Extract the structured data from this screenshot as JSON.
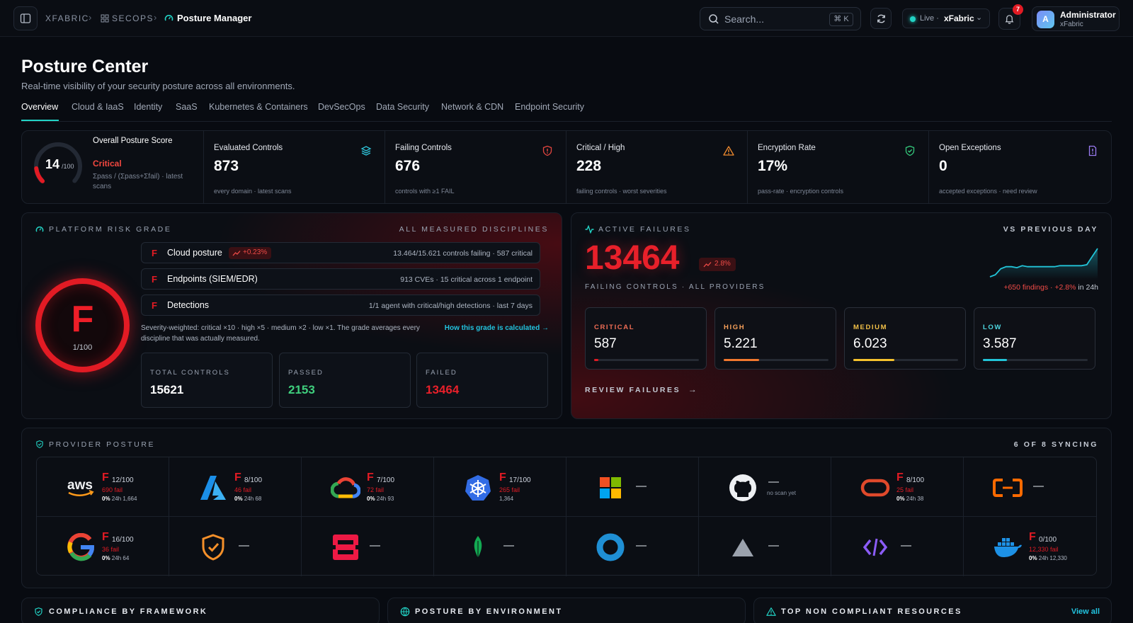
{
  "breadcrumb": {
    "root": "XFABRIC",
    "section": "SECOPS",
    "current": "Posture Manager"
  },
  "search": {
    "placeholder": "Search...",
    "shortcut": "⌘ K"
  },
  "env": {
    "live_label": "Live ·",
    "tenant": "xFabric"
  },
  "notifications": {
    "count": "7"
  },
  "user": {
    "initial": "A",
    "name": "Administrator",
    "org": "xFabric"
  },
  "page": {
    "title": "Posture Center",
    "subtitle": "Real-time visibility of your security posture across all environments."
  },
  "tabs": [
    "Overview",
    "Cloud & IaaS",
    "Identity",
    "SaaS",
    "Kubernetes & Containers",
    "DevSecOps",
    "Data Security",
    "Network & CDN",
    "Endpoint Security"
  ],
  "score": {
    "title": "Overall Posture Score",
    "value": "14",
    "max": "/100",
    "status": "Critical",
    "formula": "Σpass / (Σpass+Σfail) · latest scans",
    "fraction": 0.14
  },
  "kpis": [
    {
      "title": "Evaluated Controls",
      "value": "873",
      "sub": "every domain · latest scans",
      "icon": "layers-icon",
      "color": "#2fc2d8"
    },
    {
      "title": "Failing Controls",
      "value": "676",
      "sub": "controls with ≥1 FAIL",
      "icon": "shield-alert-icon",
      "color": "#e2453f"
    },
    {
      "title": "Critical / High",
      "value": "228",
      "sub": "failing controls · worst severities",
      "icon": "warning-icon",
      "color": "#f08a2e"
    },
    {
      "title": "Encryption Rate",
      "value": "17%",
      "sub": "pass-rate · encryption controls",
      "icon": "shield-check-icon",
      "color": "#34c77b"
    },
    {
      "title": "Open Exceptions",
      "value": "0",
      "sub": "accepted exceptions · need review",
      "icon": "file-alert-icon",
      "color": "#9b7bf2"
    }
  ],
  "risk": {
    "label": "PLATFORM RISK GRADE",
    "scope": "ALL MEASURED DISCIPLINES",
    "grade": "F",
    "score": "1/100",
    "rows": [
      {
        "grade": "F",
        "name": "Cloud posture",
        "delta": "+0.23%",
        "detail": "13.464/15.621 controls failing · 587 critical"
      },
      {
        "grade": "F",
        "name": "Endpoints (SIEM/EDR)",
        "delta": "",
        "detail": "913 CVEs · 15 critical across 1 endpoint"
      },
      {
        "grade": "F",
        "name": "Detections",
        "delta": "",
        "detail": "1/1 agent with critical/high detections · last 7 days"
      }
    ],
    "note": "Severity-weighted: critical ×10 · high ×5 · medium ×2 · low ×1. The grade averages every discipline that was actually measured.",
    "how": "How this grade is calculated →",
    "stats": [
      {
        "label": "TOTAL CONTROLS",
        "value": "15621",
        "color": "#ffffff"
      },
      {
        "label": "PASSED",
        "value": "2153",
        "color": "#3fcf7d"
      },
      {
        "label": "FAILED",
        "value": "13464",
        "color": "#e8202a"
      }
    ]
  },
  "failures": {
    "label": "ACTIVE FAILURES",
    "compare": "VS PREVIOUS DAY",
    "value": "13464",
    "delta": "2.8%",
    "caption": "FAILING CONTROLS · ALL PROVIDERS",
    "trend_red": "+650 findings · +2.8%",
    "trend_suffix": "in 24h",
    "trend": [
      30,
      32,
      38,
      40,
      40,
      39,
      41,
      40,
      40,
      40,
      40,
      40,
      40,
      41,
      41,
      41,
      41,
      41,
      42,
      50,
      58
    ],
    "severities": [
      {
        "label": "CRITICAL",
        "value": "587",
        "color": "#f06d55",
        "fill": "#e21b24",
        "fraction": 0.04
      },
      {
        "label": "HIGH",
        "value": "5.221",
        "color": "#f7a05a",
        "fill": "#f2782e",
        "fraction": 0.34
      },
      {
        "label": "MEDIUM",
        "value": "6.023",
        "color": "#f2c148",
        "fill": "#f5c22d",
        "fraction": 0.39
      },
      {
        "label": "LOW",
        "value": "3.587",
        "color": "#4dd6e0",
        "fill": "#22c4d8",
        "fraction": 0.23
      }
    ],
    "review": "REVIEW FAILURES"
  },
  "providers": {
    "label": "PROVIDER POSTURE",
    "syncing": "6 OF 8 SYNCING",
    "items": [
      {
        "logo": "aws-logo",
        "grade": "F",
        "score": "12/100",
        "fail": "690 fail",
        "meta": [
          "0%",
          "24h",
          "1,664"
        ]
      },
      {
        "logo": "azure-logo",
        "grade": "F",
        "score": "8/100",
        "fail": "46 fail",
        "meta": [
          "0%",
          "24h",
          "68"
        ]
      },
      {
        "logo": "gcp-logo",
        "grade": "F",
        "score": "7/100",
        "fail": "72 fail",
        "meta": [
          "0%",
          "24h",
          "93"
        ]
      },
      {
        "logo": "kubernetes-logo",
        "grade": "F",
        "score": "17/100",
        "fail": "265 fail",
        "meta": [
          "",
          "",
          "1,364"
        ]
      },
      {
        "logo": "microsoft-logo",
        "dash": "—"
      },
      {
        "logo": "github-logo",
        "dash": "—",
        "note": "no scan yet"
      },
      {
        "logo": "oracle-logo",
        "grade": "F",
        "score": "8/100",
        "fail": "25 fail",
        "meta": [
          "0%",
          "24h",
          "38"
        ]
      },
      {
        "logo": "alibaba-logo",
        "dash": "—"
      },
      {
        "logo": "google-logo",
        "grade": "F",
        "score": "16/100",
        "fail": "36 fail",
        "meta": [
          "0%",
          "24h",
          "64"
        ]
      },
      {
        "logo": "shield-logo",
        "dash": "—"
      },
      {
        "logo": "openstack-logo",
        "dash": "—"
      },
      {
        "logo": "mongodb-logo",
        "dash": "—"
      },
      {
        "logo": "ring-logo",
        "dash": "—"
      },
      {
        "logo": "triangle-logo",
        "dash": "—"
      },
      {
        "logo": "code-logo",
        "dash": "—"
      },
      {
        "logo": "docker-logo",
        "grade": "F",
        "score": "0/100",
        "fail": "12,330 fail",
        "meta": [
          "0%",
          "24h",
          "12,330"
        ]
      }
    ]
  },
  "bottom": [
    {
      "title": "COMPLIANCE BY FRAMEWORK"
    },
    {
      "title": "POSTURE BY ENVIRONMENT"
    },
    {
      "title": "TOP NON COMPLIANT RESOURCES",
      "link": "View all"
    }
  ]
}
